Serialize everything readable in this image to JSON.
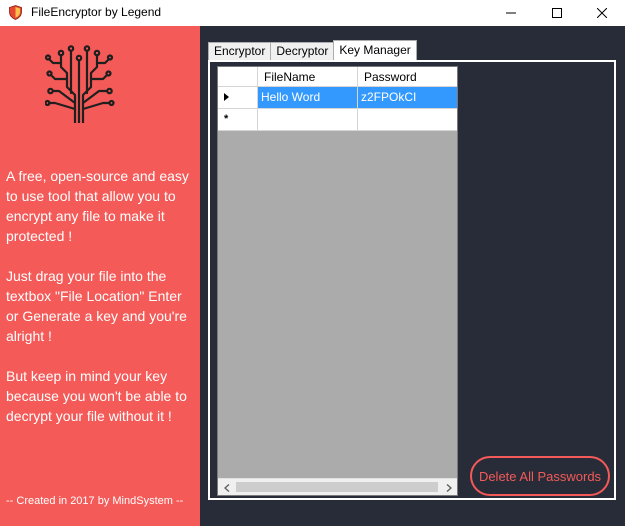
{
  "window": {
    "title": "FileEncryptor by Legend"
  },
  "left_panel": {
    "background": "#f45a57",
    "paragraphs": [
      "A free, open-source and easy to use tool that allow you to encrypt any file to make it protected !",
      "Just drag your file into the textbox \"File Location\" Enter or Generate a key and you're alright !",
      "But keep in mind your key because you won't be able to decrypt your file without it !"
    ],
    "footer": "-- Created in 2017 by MindSystem --"
  },
  "tabs": [
    {
      "label": "Encryptor",
      "active": false
    },
    {
      "label": "Decryptor",
      "active": false
    },
    {
      "label": "Key Manager",
      "active": true
    }
  ],
  "grid": {
    "columns": [
      "FileName",
      "Password"
    ],
    "rows": [
      {
        "marker": "current-row",
        "FileName": "Hello Word",
        "Password": "z2FPOkCI",
        "selected": true
      }
    ],
    "new_row_marker": "*"
  },
  "actions": {
    "delete_all_label": "Delete All Passwords"
  },
  "colors": {
    "accent": "#f45a57",
    "dark_bg": "#272c38",
    "selection": "#3399ff"
  }
}
